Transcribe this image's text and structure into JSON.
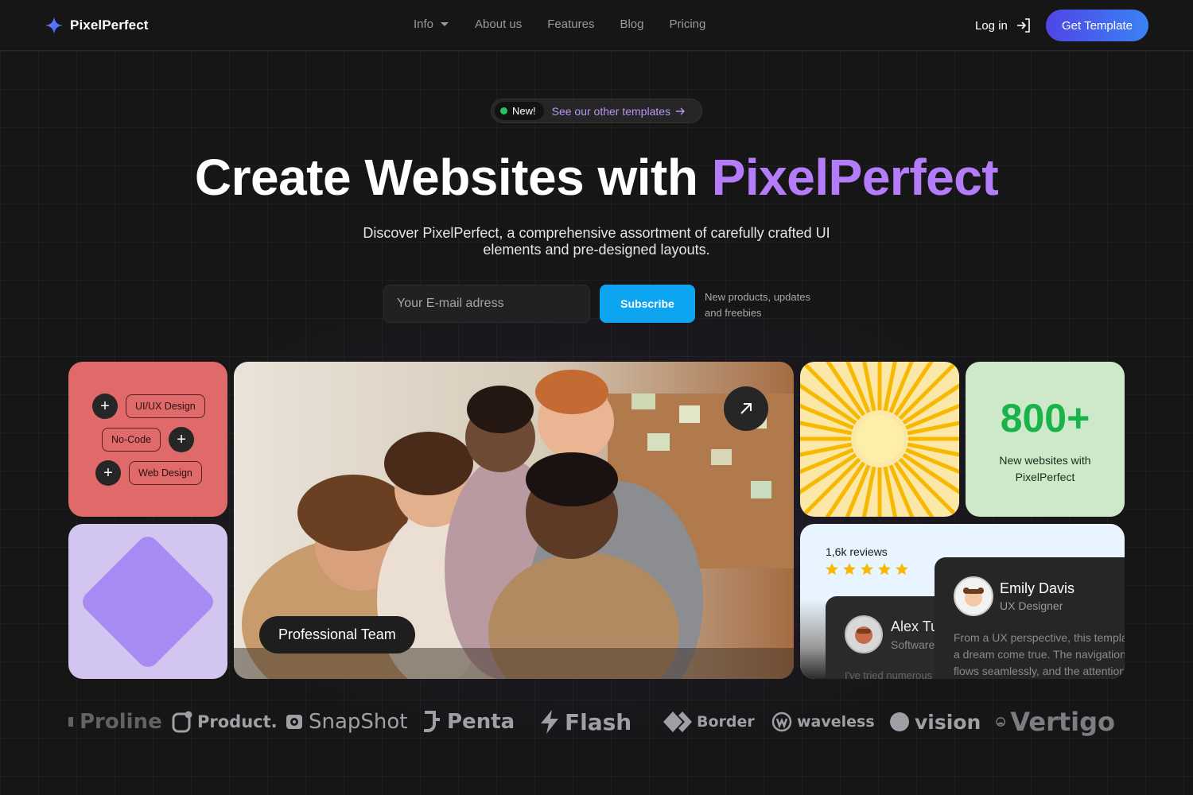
{
  "nav": {
    "brand": "PixelPerfect",
    "menu": [
      "Info",
      "About us",
      "Features",
      "Blog",
      "Pricing"
    ],
    "login": "Log in",
    "cta": "Get Template"
  },
  "hero": {
    "badge_new": "New!",
    "badge_link": "See our other templates",
    "title_main": "Create Websites with ",
    "title_accent": "PixelPerfect",
    "subtitle": "Discover PixelPerfect, a comprehensive assortment of carefully crafted UI elements and pre-designed layouts.",
    "email_placeholder": "Your E-mail adress",
    "subscribe": "Subscribe",
    "note": "New products, updates and freebies"
  },
  "cards": {
    "tags": [
      "UI/UX Design",
      "No-Code",
      "Web Design"
    ],
    "photo_label": "Professional Team",
    "stat_value": "800+",
    "stat_text": "New websites with PixelPerfect",
    "reviews_count": "1,6k reviews",
    "rating_stars": 5,
    "review_back_name": "Alex Tu",
    "review_back_role": "Software",
    "review_back_text": "I've tried numerous templates, but this",
    "review_front_name": "Emily Davis",
    "review_front_role": "UX Designer",
    "review_front_text": "From a UX perspective, this template is a dream come true. The navigation flows seamlessly, and the attention"
  },
  "logos": [
    "Proline",
    "Product.",
    "SnapShot",
    "Penta",
    "Flash",
    "Border",
    "waveless",
    "vision",
    "Vertigo"
  ],
  "colors": {
    "accent_purple": "#b47cf8",
    "cta_blue": "#4f46e5",
    "subscribe_blue": "#0ea5f0",
    "stat_green": "#1ab34a",
    "star_yellow": "#f6b800"
  }
}
